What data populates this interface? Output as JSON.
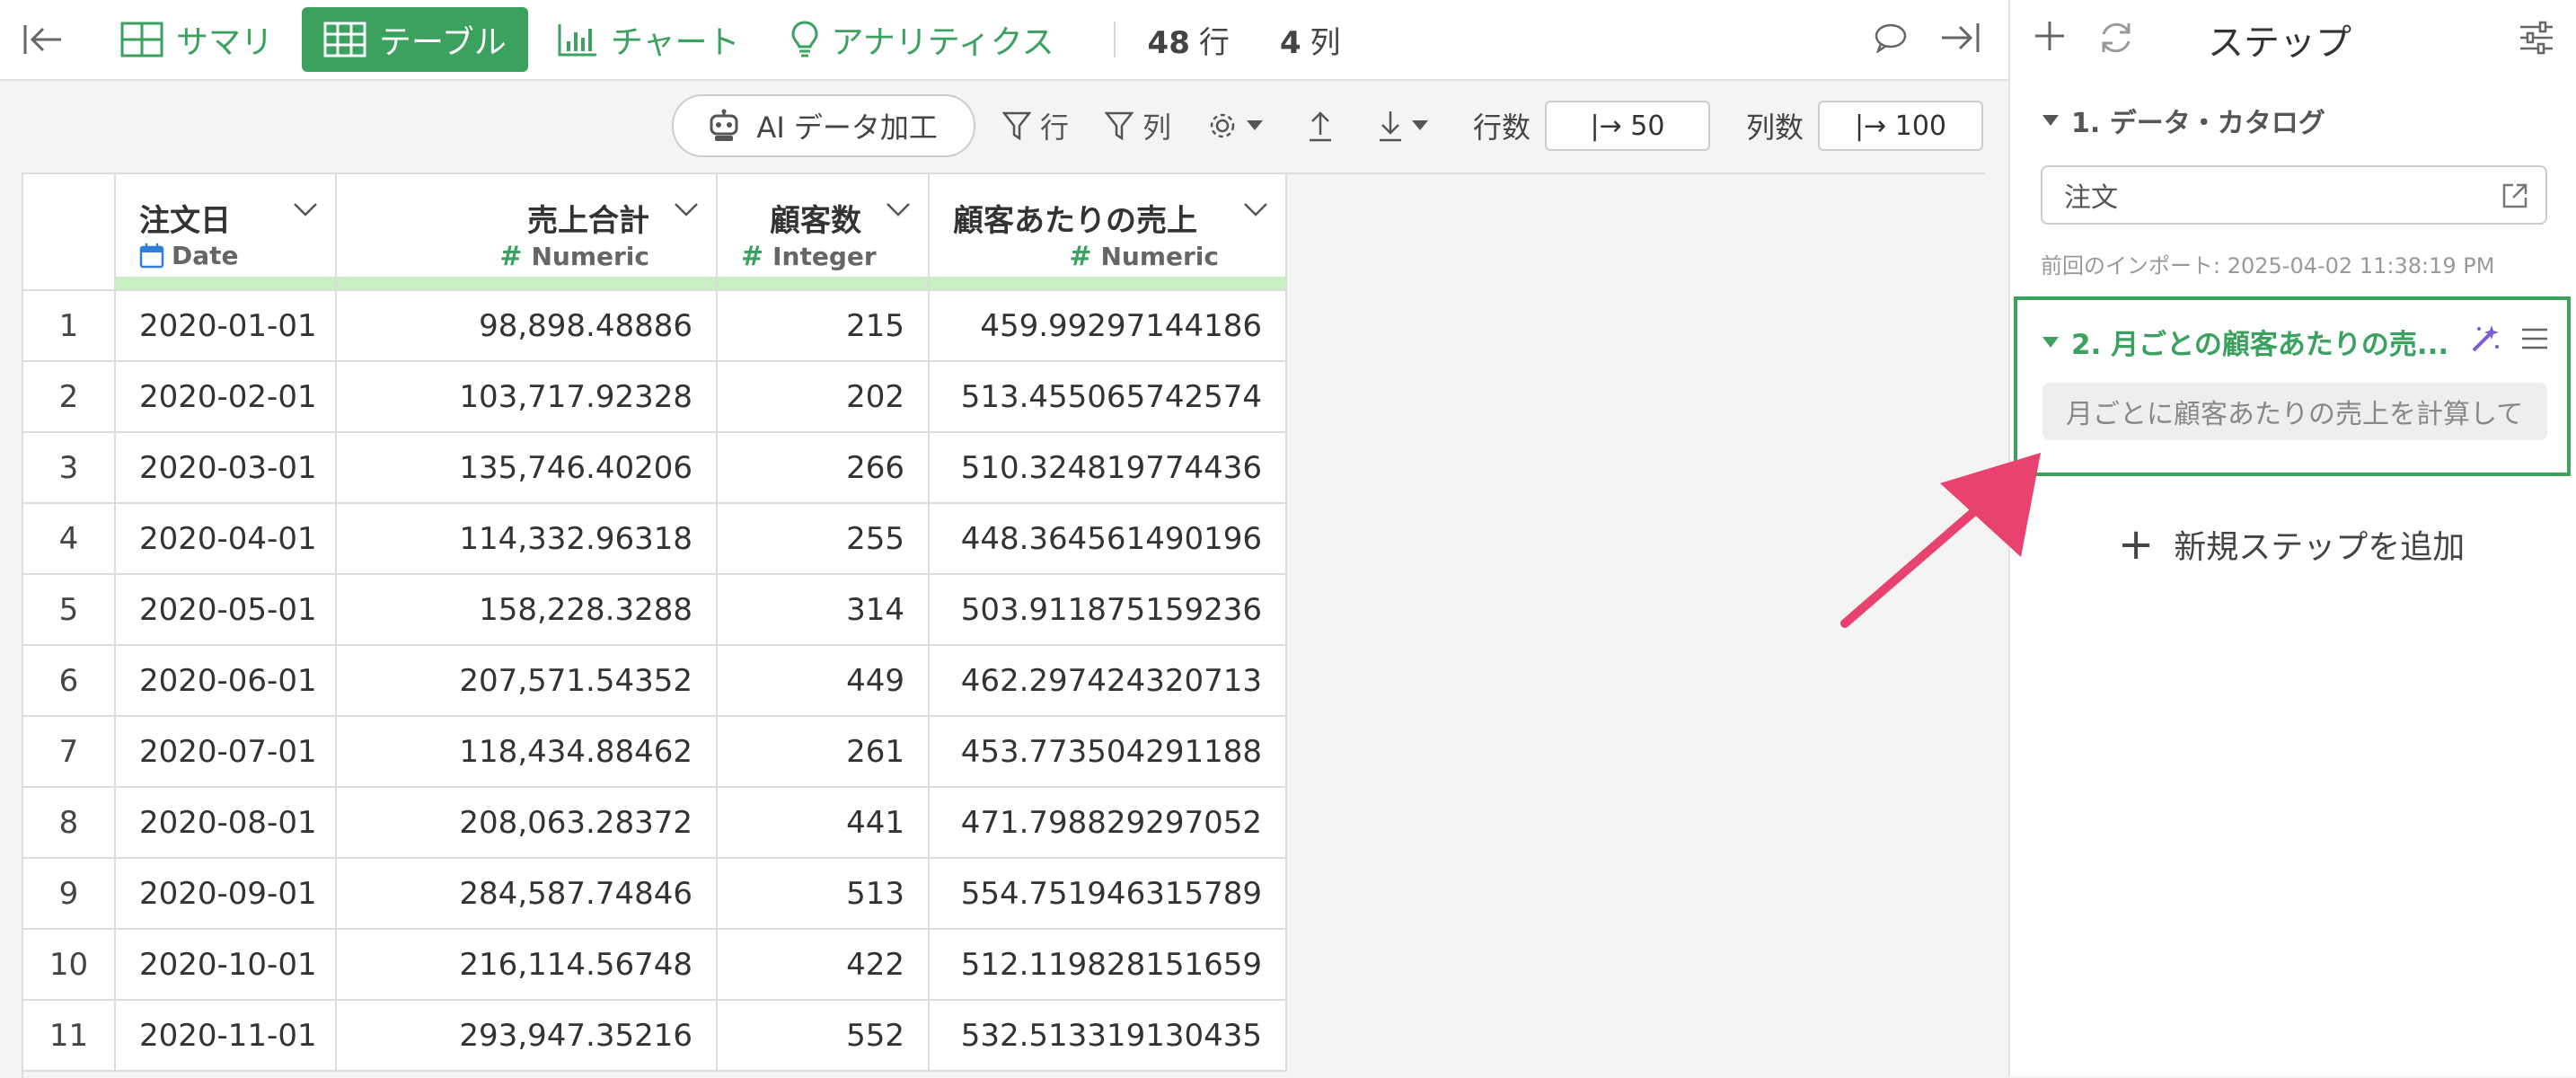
{
  "topbar": {
    "tabs": [
      {
        "label": "サマリ",
        "icon": "table-outline-icon"
      },
      {
        "label": "テーブル",
        "icon": "table-grid-icon",
        "active": true
      },
      {
        "label": "チャート",
        "icon": "bar-chart-icon"
      },
      {
        "label": "アナリティクス",
        "icon": "lightbulb-icon"
      }
    ],
    "rows_count": "48",
    "rows_unit": "行",
    "cols_count": "4",
    "cols_unit": "列"
  },
  "toolbar": {
    "ai_label": "AI データ加工",
    "filter_rows": "行",
    "filter_cols": "列",
    "rows_label": "行数",
    "rows_value": "|→ 50",
    "cols_label": "列数",
    "cols_value": "|→ 100"
  },
  "table": {
    "columns": [
      {
        "name": "注文日",
        "type": "Date"
      },
      {
        "name": "売上合計",
        "type": "Numeric"
      },
      {
        "name": "顧客数",
        "type": "Integer"
      },
      {
        "name": "顧客あたりの売上",
        "type": "Numeric"
      }
    ],
    "rows": [
      [
        "1",
        "2020-01-01",
        "98,898.48886",
        "215",
        "459.99297144186"
      ],
      [
        "2",
        "2020-02-01",
        "103,717.92328",
        "202",
        "513.455065742574"
      ],
      [
        "3",
        "2020-03-01",
        "135,746.40206",
        "266",
        "510.324819774436"
      ],
      [
        "4",
        "2020-04-01",
        "114,332.96318",
        "255",
        "448.364561490196"
      ],
      [
        "5",
        "2020-05-01",
        "158,228.3288",
        "314",
        "503.911875159236"
      ],
      [
        "6",
        "2020-06-01",
        "207,571.54352",
        "449",
        "462.297424320713"
      ],
      [
        "7",
        "2020-07-01",
        "118,434.88462",
        "261",
        "453.773504291188"
      ],
      [
        "8",
        "2020-08-01",
        "208,063.28372",
        "441",
        "471.798829297052"
      ],
      [
        "9",
        "2020-09-01",
        "284,587.74846",
        "513",
        "554.751946315789"
      ],
      [
        "10",
        "2020-10-01",
        "216,114.56748",
        "422",
        "512.119828151659"
      ],
      [
        "11",
        "2020-11-01",
        "293,947.35216",
        "552",
        "532.513319130435"
      ]
    ]
  },
  "panel": {
    "title": "ステップ",
    "step1_title": "1. データ・カタログ",
    "step1_source": "注文",
    "step1_import": "前回のインポート: 2025-04-02 11:38:19 PM",
    "step2_title": "2. 月ごとの顧客あたりの売...",
    "step2_desc": "月ごとに顧客あたりの売上を計算して",
    "add_step": "新規ステップを追加"
  },
  "colors": {
    "accent": "#3aa15e",
    "arrow": "#e8436f",
    "highlight": "#c9f0c3",
    "wand": "#7b5cd6"
  }
}
